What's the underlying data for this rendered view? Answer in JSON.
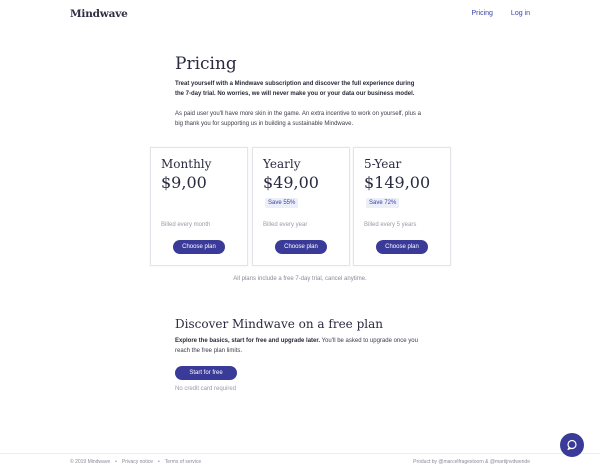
{
  "header": {
    "logo": "Mindwave",
    "nav": [
      {
        "label": "Pricing"
      },
      {
        "label": "Log in"
      }
    ]
  },
  "intro": {
    "title": "Pricing",
    "lead": "Treat yourself with a Mindwave subscription and discover the full experience during the 7-day trial. No worries, we will never make you or your data our business model.",
    "paragraph": "As paid user you'll have more skin in the game. An extra incentive to work on yourself, plus a big thank you for supporting us in building a sustainable Mindwave."
  },
  "plans": [
    {
      "name": "Monthly",
      "price": "$9,00",
      "save": "",
      "billed": "Billed every month",
      "button": "Choose plan"
    },
    {
      "name": "Yearly",
      "price": "$49,00",
      "save": "Save 55%",
      "billed": "Billed every year",
      "button": "Choose plan"
    },
    {
      "name": "5-Year",
      "price": "$149,00",
      "save": "Save 72%",
      "billed": "Billed every 5 years",
      "button": "Choose plan"
    }
  ],
  "trial_note": "All plans include a free 7-day trial, cancel anytime.",
  "free_plan": {
    "title": "Discover Mindwave on a free plan",
    "desc_bold": "Explore the basics, start for free and upgrade later.",
    "desc_rest": " You'll be asked to upgrade once you reach the free plan limits.",
    "button": "Start for free",
    "note": "No credit card required"
  },
  "footer": {
    "copyright": "© 2019 Mindwave",
    "privacy": "Privacy notice",
    "terms": "Terms of service",
    "credit": "Product by @marcelfragestoorn & @martijnvdwende"
  },
  "help_icon": "chat-bubble-icon",
  "colors": {
    "accent": "#3a3b99",
    "text": "#2a2a40",
    "muted": "#9a9aa8"
  }
}
